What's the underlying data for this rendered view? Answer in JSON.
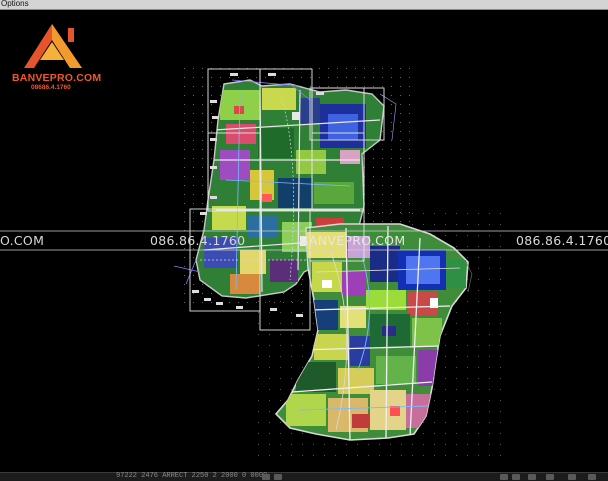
{
  "window": {
    "menu_label": "Options"
  },
  "branding": {
    "brand_name": "BANVEPRO.COM",
    "brand_phone": "08686.4.1760",
    "brand_color": "#f0582a"
  },
  "watermark": {
    "left_text": "O.COM",
    "phone_text_left": "086.86.4.1760",
    "center_text": "BANVEPRO.COM",
    "phone_text_right": "086.86.4.1760"
  },
  "statusbar": {
    "coords_text": "97222 2476 ARRECT 2250 2 2000 0 0000"
  },
  "icons": {
    "logo": "house-roof-logo-icon",
    "status": [
      "snap-icon",
      "grid-icon",
      "ortho-icon",
      "polar-icon",
      "osnap-icon",
      "otrack-icon",
      "lineweight-icon",
      "model-icon"
    ]
  }
}
